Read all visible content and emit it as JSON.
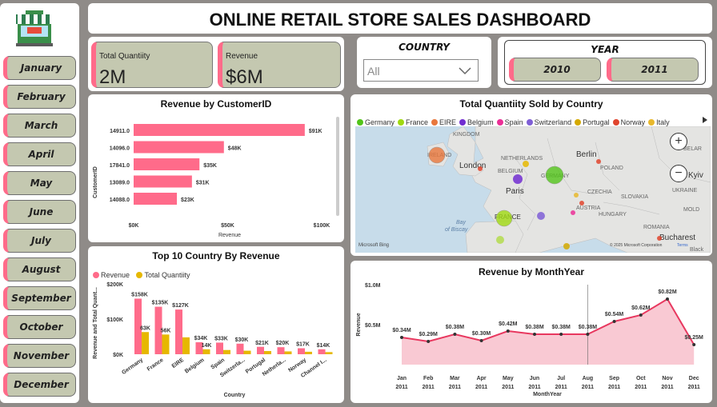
{
  "title": "ONLINE RETAIL STORE SALES DASHBOARD",
  "months": [
    "January",
    "February",
    "March",
    "April",
    "May",
    "June",
    "July",
    "August",
    "September",
    "October",
    "November",
    "December"
  ],
  "kpis": {
    "quantity_label": "Total Quantiity",
    "quantity_value": "2M",
    "revenue_label": "Revenue",
    "revenue_value": "$6M"
  },
  "country_slicer": {
    "title": "COUNTRY",
    "value": "All"
  },
  "year_slicer": {
    "title": "YEAR",
    "options": [
      "2010",
      "2011"
    ]
  },
  "colors": {
    "pink": "#ff6b8a",
    "gold": "#e6b800",
    "kpi_bg": "#c4c8b0"
  },
  "customer_chart": {
    "title": "Revenue by CustomerID",
    "ylabel": "CustomerID",
    "xlabel": "Revenue",
    "ticks": [
      "$0K",
      "$50K",
      "$100K"
    ],
    "tick_values": [
      0,
      50,
      100
    ],
    "xmax": 100,
    "categories": [
      "14911.0",
      "14096.0",
      "17841.0",
      "13089.0",
      "14088.0"
    ],
    "values": [
      91,
      48,
      35,
      31,
      23
    ],
    "labels": [
      "$91K",
      "$48K",
      "$35K",
      "$31K",
      "$23K"
    ]
  },
  "map": {
    "title": "Total Quantiity Sold by Country",
    "legend": [
      {
        "name": "Germany",
        "color": "#52c41a"
      },
      {
        "name": "France",
        "color": "#a0d911"
      },
      {
        "name": "EIRE",
        "color": "#e8773c"
      },
      {
        "name": "Belgium",
        "color": "#722ed1"
      },
      {
        "name": "Spain",
        "color": "#eb2f96"
      },
      {
        "name": "Switzerland",
        "color": "#7f5fd6"
      },
      {
        "name": "Portugal",
        "color": "#d4a900"
      },
      {
        "name": "Norway",
        "color": "#e0452e"
      },
      {
        "name": "Italy",
        "color": "#e8b82c"
      }
    ],
    "place_labels": {
      "kingdom": "KINGDOM",
      "netherlands": "NETHERLANDS",
      "london": "London",
      "berlin": "Berlin",
      "poland": "POLAND",
      "germany": "GERMANY",
      "ireland": "IRELAND",
      "belgium": "BELGIUM",
      "paris": "Paris",
      "czechia": "CZECHIA",
      "slovakia": "SLOVAKIA",
      "ukraine": "UKRAINE",
      "kyiv": "Kyiv",
      "belarus": "BELAR",
      "france": "FRANCE",
      "austria": "AUSTRIA",
      "hungary": "HUNGARY",
      "moldova": "MOLD",
      "bay": "Bay",
      "biscay": "of Biscay",
      "romania": "ROMANIA",
      "bucharest": "Bucharest",
      "black": "Black",
      "bing": "Microsoft Bing",
      "copyright": "© 2025 Microsoft Corporation",
      "terms": "Terms"
    }
  },
  "country_chart": {
    "title": "Top 10 Country By Revenue",
    "legend": [
      "Revenue",
      "Total Quantiity"
    ],
    "ylabel": "Revenue and Total Quant...",
    "xlabel": "Country",
    "yticks": [
      "$200K",
      "$100K",
      "$0K"
    ],
    "ytick_values": [
      200,
      100,
      0
    ],
    "ymax": 200,
    "categories": [
      "Germany",
      "France",
      "EIRE",
      "Belgium",
      "Spain",
      "Switzerla...",
      "Portugal",
      "Netherla...",
      "Norway",
      "Channel I..."
    ],
    "revenue": [
      158,
      135,
      127,
      34,
      33,
      30,
      21,
      20,
      17,
      14
    ],
    "revenue_labels": [
      "$158K",
      "$135K",
      "$127K",
      "$34K",
      "$33K",
      "$30K",
      "$21K",
      "$20K",
      "$17K",
      "$14K"
    ],
    "quantity": [
      63,
      56,
      48,
      14,
      12,
      10,
      9,
      8,
      7,
      6
    ],
    "quantity_labels": [
      "63K",
      "56K",
      "",
      "14K",
      "",
      "",
      "",
      "",
      "",
      ""
    ]
  },
  "month_chart": {
    "title": "Revenue by MonthYear",
    "ylabel": "Revenue",
    "xlabel": "MonthYear",
    "yticks": [
      "$1.0M",
      "$0.5M"
    ],
    "ytick_values": [
      1.0,
      0.5
    ],
    "ymax": 1.0,
    "categories": [
      "Jan",
      "Feb",
      "Mar",
      "Apr",
      "May",
      "Jun",
      "Jul",
      "Aug",
      "Sep",
      "Oct",
      "Nov",
      "Dec"
    ],
    "years": [
      "2011",
      "2011",
      "2011",
      "2011",
      "2011",
      "2011",
      "2011",
      "2011",
      "2011",
      "2011",
      "2011",
      "2011"
    ],
    "values": [
      0.34,
      0.29,
      0.38,
      0.3,
      0.42,
      0.38,
      0.38,
      0.38,
      0.54,
      0.62,
      0.82,
      0.25
    ],
    "labels": [
      "$0.34M",
      "$0.29M",
      "$0.38M",
      "$0.30M",
      "$0.42M",
      "$0.38M",
      "$0.38M",
      "$0.38M",
      "$0.54M",
      "$0.62M",
      "$0.82M",
      "$0.25M"
    ]
  }
}
